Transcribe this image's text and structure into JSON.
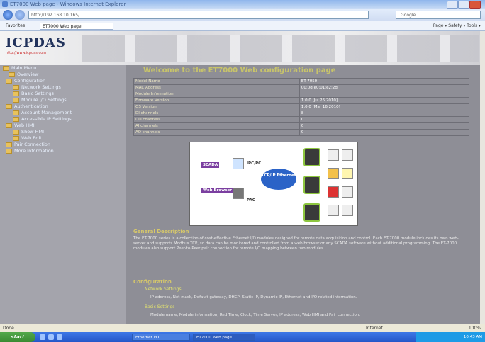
{
  "window": {
    "title": "ET7000 Web page - Windows Internet Explorer"
  },
  "address": {
    "url": "http://192.168.10.165/",
    "search_placeholder": "Google"
  },
  "favorites": {
    "label": "Favorites",
    "tab": "ET7000 Web page",
    "tools": "Page ▾  Safety ▾  Tools ▾"
  },
  "header": {
    "logo": "ICPDAS",
    "logo_sub": "http://www.icpdas.com"
  },
  "sidebar": {
    "items": [
      {
        "label": "Main Menu"
      },
      {
        "label": "Overview"
      },
      {
        "label": "Configuration"
      },
      {
        "label": "Network Settings"
      },
      {
        "label": "Basic Settings"
      },
      {
        "label": "Module I/O Settings"
      },
      {
        "label": "Authentication"
      },
      {
        "label": "Account Management"
      },
      {
        "label": "Accessible IP Settings"
      },
      {
        "label": "Web HMI"
      },
      {
        "label": "Show HMI"
      },
      {
        "label": "Web Edit"
      },
      {
        "label": "Pair Connection"
      },
      {
        "label": "More Information"
      }
    ]
  },
  "main": {
    "welcome": "Welcome to the ET7000 Web configuration page",
    "info": [
      {
        "k": "Model Name",
        "v": "ET-7050"
      },
      {
        "k": "MAC Address",
        "v": "00:0d:e0:01:e2:2d"
      },
      {
        "k": "Module Information",
        "v": ""
      },
      {
        "k": "Firmware Version",
        "v": "1.0.0 [Jul 26 2010]"
      },
      {
        "k": "OS Version",
        "v": "1.0.0 [Mar 16 2010]"
      },
      {
        "k": "DI channels",
        "v": "8"
      },
      {
        "k": "DO channels",
        "v": "0"
      },
      {
        "k": "AI channels",
        "v": "0"
      },
      {
        "k": "AO channels",
        "v": "0"
      }
    ],
    "diagram": {
      "scada": "SCADA",
      "ipc": "IPC/PC",
      "web": "Web Browser",
      "pac": "PAC",
      "cloud": "TCP/IP Ethernet"
    },
    "general_title": "General Description",
    "general_text": "The ET-7000 series is a collection of cost-effective Ethernet I/O modules designed for remote data acquisition and control. Each ET-7000 module includes its own web-server and supports Modbus TCP, so data can be monitored and controlled from a web browser or any SCADA software without additional programming. The ET-7000 modules also support Peer-to-Peer pair connection for remote I/O mapping between two modules.",
    "config_title": "Configuration",
    "bullets": [
      {
        "title": "Network Settings",
        "text": "IP address, Net mask, Default gateway, DHCP, Static IP, Dynamic IP, Ethernet and I/O related information."
      },
      {
        "title": "Basic Settings",
        "text": "Module name, Module information, Red Time, Clock, Time Server, IP address, Web HMI and Pair connection."
      }
    ]
  },
  "status": {
    "left": "Done",
    "zone": "Internet",
    "zoom": "100%"
  },
  "taskbar": {
    "start": "start",
    "task1": "Ethernet I/O...",
    "task2": "ET7000 Web page ...",
    "time": "10:43 AM"
  }
}
